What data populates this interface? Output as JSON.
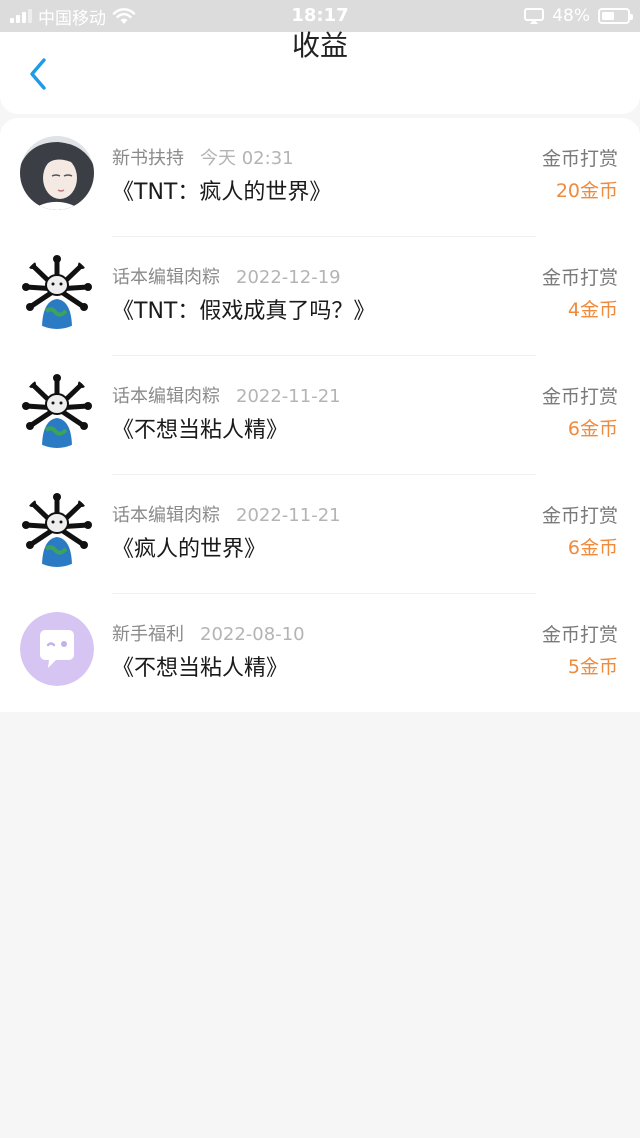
{
  "status_bar": {
    "carrier": "中国移动",
    "time": "18:17",
    "battery": "48%",
    "battery_level": 0.48
  },
  "header": {
    "title": "收益"
  },
  "earnings": [
    {
      "source": "新书扶持",
      "date": "今天 02:31",
      "book": "《TNT：疯人的世界》",
      "type": "金币打赏",
      "amount": "20金币",
      "avatar": "anime-avatar"
    },
    {
      "source": "话本编辑肉粽",
      "date": "2022-12-19",
      "book": "《TNT：假戏成真了吗？》",
      "type": "金币打赏",
      "amount": "4金币",
      "avatar": "editor-avatar"
    },
    {
      "source": "话本编辑肉粽",
      "date": "2022-11-21",
      "book": "《不想当粘人精》",
      "type": "金币打赏",
      "amount": "6金币",
      "avatar": "editor-avatar"
    },
    {
      "source": "话本编辑肉粽",
      "date": "2022-11-21",
      "book": "《疯人的世界》",
      "type": "金币打赏",
      "amount": "6金币",
      "avatar": "editor-avatar"
    },
    {
      "source": "新手福利",
      "date": "2022-08-10",
      "book": "《不想当粘人精》",
      "type": "金币打赏",
      "amount": "5金币",
      "avatar": "chat-bubble-avatar"
    }
  ],
  "colors": {
    "accent": "#1e9be8",
    "amount": "#f08a3c",
    "avatar_purple": "#d6c4f3"
  }
}
